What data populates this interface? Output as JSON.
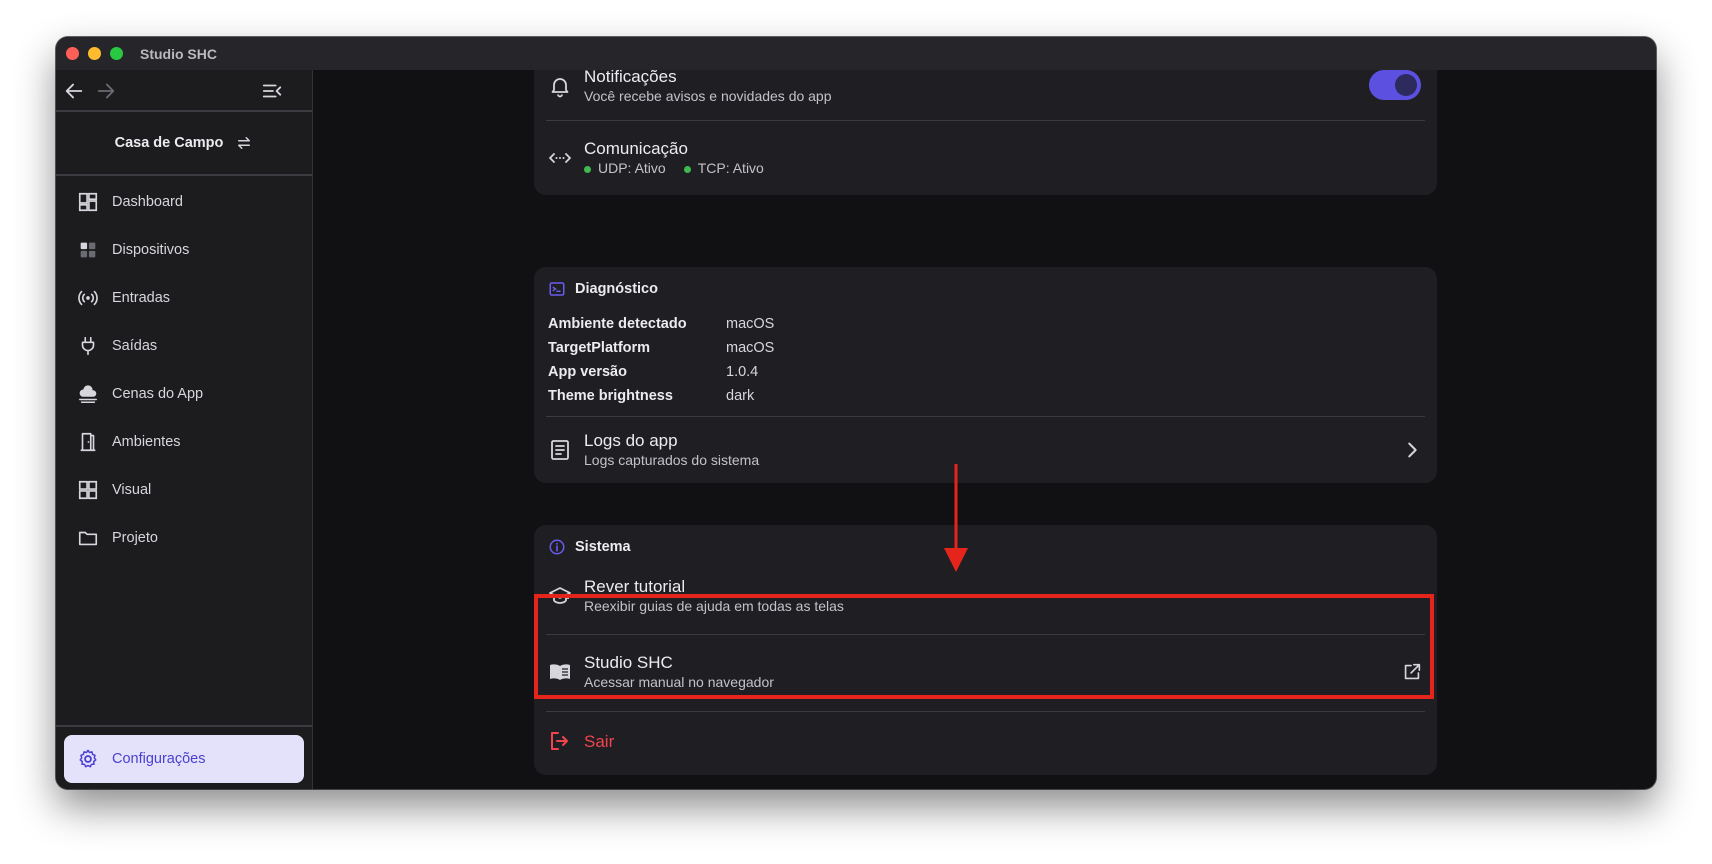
{
  "window": {
    "title": "Studio SHC"
  },
  "sidebar": {
    "project": "Casa de Campo",
    "items": [
      {
        "label": "Dashboard",
        "icon": "dashboard-icon"
      },
      {
        "label": "Dispositivos",
        "icon": "devices-icon"
      },
      {
        "label": "Entradas",
        "icon": "broadcast-icon"
      },
      {
        "label": "Saídas",
        "icon": "plug-icon"
      },
      {
        "label": "Cenas do App",
        "icon": "cloud-icon"
      },
      {
        "label": "Ambientes",
        "icon": "door-icon"
      },
      {
        "label": "Visual",
        "icon": "grid-icon"
      },
      {
        "label": "Projeto",
        "icon": "folder-icon"
      }
    ],
    "settings": {
      "label": "Configurações",
      "icon": "gear-icon"
    }
  },
  "colors": {
    "accent": "#5b50e0",
    "danger": "#e5251b",
    "status_ok": "#3fb950"
  },
  "notifications": {
    "title": "Notificações",
    "subtitle": "Você recebe avisos e novidades do app",
    "toggle_on": true
  },
  "communication": {
    "title": "Comunicação",
    "udp": "UDP: Ativo",
    "tcp": "TCP: Ativo"
  },
  "diagnostics": {
    "header": "Diagnóstico",
    "rows": [
      {
        "key": "Ambiente detectado",
        "value": "macOS"
      },
      {
        "key": "TargetPlatform",
        "value": "macOS"
      },
      {
        "key": "App versão",
        "value": "1.0.4"
      },
      {
        "key": "Theme brightness",
        "value": "dark"
      }
    ],
    "logs": {
      "title": "Logs do app",
      "subtitle": "Logs capturados do sistema"
    }
  },
  "system": {
    "header": "Sistema",
    "tutorial": {
      "title": "Rever tutorial",
      "subtitle": "Reexibir guias de ajuda em todas as telas"
    },
    "manual": {
      "title": "Studio SHC",
      "subtitle": "Acessar manual no navegador"
    },
    "logout": {
      "label": "Sair"
    }
  }
}
